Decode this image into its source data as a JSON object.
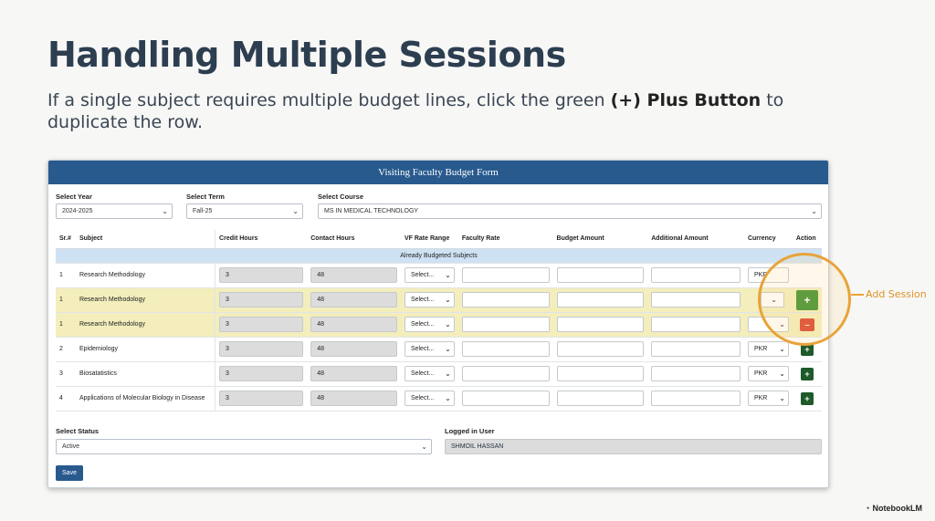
{
  "slide": {
    "title": "Handling Multiple Sessions",
    "subtitle_pre": "If a single subject requires multiple budget lines, click the green ",
    "subtitle_bold": "(+) Plus Button",
    "subtitle_post": " to duplicate the row.",
    "callout": "Add Session",
    "brand": "NotebookLM"
  },
  "form": {
    "header": "Visiting Faculty Budget Form",
    "year_label": "Select Year",
    "year_value": "2024-2025",
    "term_label": "Select Term",
    "term_value": "Fall-25",
    "course_label": "Select Course",
    "course_value": "MS IN MEDICAL TECHNOLOGY",
    "columns": [
      "Sr.#",
      "Subject",
      "Credit Hours",
      "Contact Hours",
      "VF Rate Range",
      "Faculty Rate",
      "Budget Amount",
      "Additional Amount",
      "Currency",
      "Action"
    ],
    "group_label": "Already Budgeted Subjects",
    "rows": [
      {
        "sr": "1",
        "subject": "Research Methodology",
        "credit": "3",
        "contact": "48",
        "vf": "Select...",
        "currency": "PKR"
      },
      {
        "sr": "1",
        "subject": "Research Methodology",
        "credit": "3",
        "contact": "48",
        "vf": "Select...",
        "currency": ""
      },
      {
        "sr": "1",
        "subject": "Research Methodology",
        "credit": "3",
        "contact": "48",
        "vf": "Select...",
        "currency": ""
      },
      {
        "sr": "2",
        "subject": "Epidemiology",
        "credit": "3",
        "contact": "48",
        "vf": "Select...",
        "currency": "PKR"
      },
      {
        "sr": "3",
        "subject": "Biosatatistics",
        "credit": "3",
        "contact": "48",
        "vf": "Select...",
        "currency": "PKR"
      },
      {
        "sr": "4",
        "subject": "Applications of Molecular Biology in Disease",
        "credit": "3",
        "contact": "48",
        "vf": "Select...",
        "currency": "PKR"
      }
    ],
    "add_label": "+",
    "remove_label": "–",
    "status_label": "Select Status",
    "status_value": "Active",
    "user_label": "Logged in User",
    "user_value": "SHMOIL HASSAN",
    "save_label": "Save"
  },
  "colors": {
    "header": "#285a8e",
    "highlight": "#f3eebc",
    "add": "#3c8f2e",
    "remove": "#d9442f",
    "callout": "#e8a33a"
  }
}
